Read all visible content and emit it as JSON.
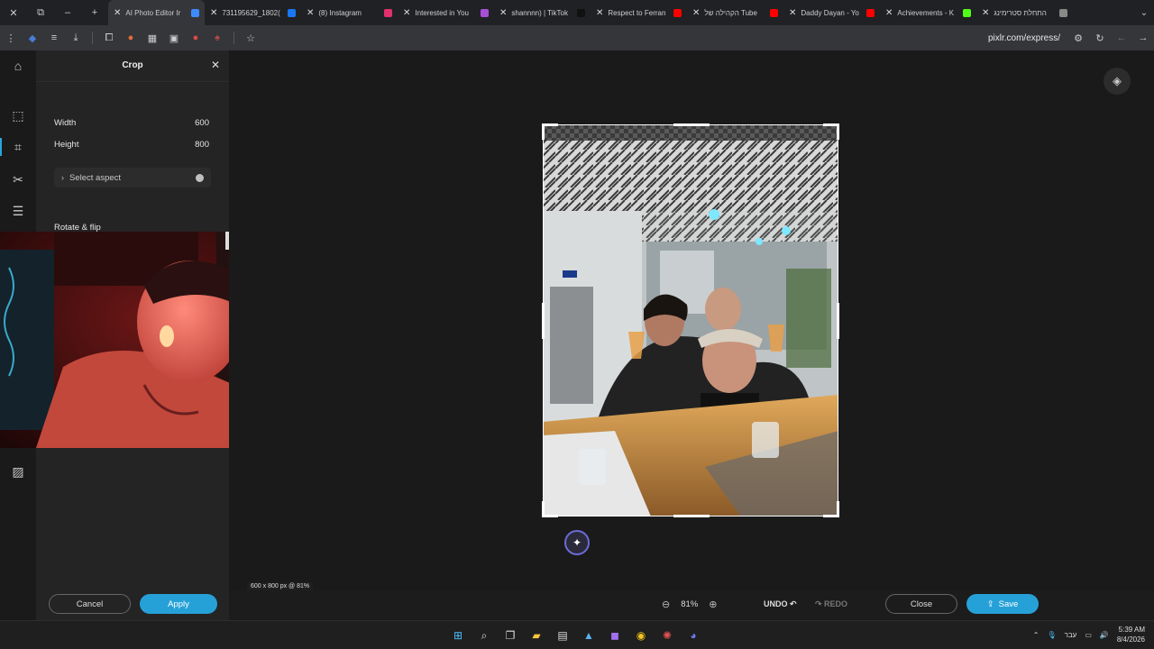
{
  "browser": {
    "tabs": [
      {
        "title": "AI Photo Editor Ir",
        "active": true,
        "fav": "#3d8bfd"
      },
      {
        "title": "731195629_1802(",
        "fav": "#1877f2"
      },
      {
        "title": "(8) Instagram",
        "fav": "#e1306c"
      },
      {
        "title": "Interested in You",
        "fav": "#a64fd6"
      },
      {
        "title": "shannnn) | TikTok",
        "fav": "#111111"
      },
      {
        "title": "Respect to Ferran",
        "fav": "#ff0000"
      },
      {
        "title": "הקהילה של Tube",
        "fav": "#ff0000"
      },
      {
        "title": "Daddy Dayan - Yo",
        "fav": "#ff0000"
      },
      {
        "title": "Achievements - K",
        "fav": "#53fc18"
      },
      {
        "title": "התחלת סטרימינג",
        "fav": "#888888"
      }
    ],
    "url": "pixlr.com/express/"
  },
  "panel": {
    "title": "Crop",
    "width_label": "Width",
    "width_value": "600",
    "height_label": "Height",
    "height_value": "800",
    "aspect_label": "Select aspect",
    "rotate_label": "Rotate & flip",
    "cancel_label": "Cancel",
    "apply_label": "Apply"
  },
  "status": {
    "size_info": "600 x 800 px @ 81%",
    "zoom_level": "81%",
    "undo_label": "UNDO",
    "redo_label": "REDO",
    "close_label": "Close",
    "save_label": "Save"
  },
  "taskbar": {
    "lang": "עבר",
    "time": "5:39 AM",
    "date": "8/4/2026"
  },
  "colors": {
    "accent": "#26a1d8"
  }
}
